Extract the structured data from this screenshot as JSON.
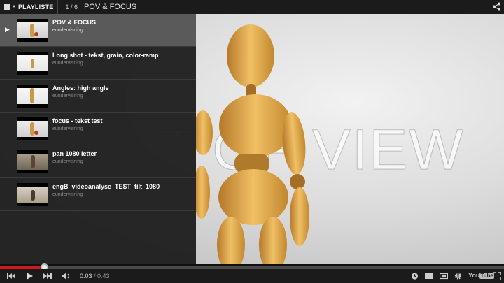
{
  "topbar": {
    "playlist_label": "PLAYLISTE",
    "position": "1 / 6",
    "video_title": "POV & FOCUS"
  },
  "video": {
    "overlay_text": "T OF VIEW"
  },
  "playlist": {
    "items": [
      {
        "title": "POV & FOCUS",
        "channel": "eundervisning",
        "active": true
      },
      {
        "title": "Long shot - tekst, grain, color-ramp",
        "channel": "eundervisning",
        "active": false
      },
      {
        "title": "Angles: high angle",
        "channel": "eundervisning",
        "active": false
      },
      {
        "title": "focus - tekst test",
        "channel": "eundervisning",
        "active": false
      },
      {
        "title": "pan 1080 letter",
        "channel": "eundervisning",
        "active": false
      },
      {
        "title": "engB_videoanalyse_TEST_tilt_1080",
        "channel": "eundervisning",
        "active": false
      }
    ]
  },
  "player": {
    "current_time": "0:03",
    "separator": " / ",
    "duration": "0:43",
    "progress_fraction": 0.087,
    "logo_you": "You",
    "logo_tube": "Tube"
  },
  "colors": {
    "progress_played": "#cc181e",
    "active_row": "#5a5a5a"
  }
}
